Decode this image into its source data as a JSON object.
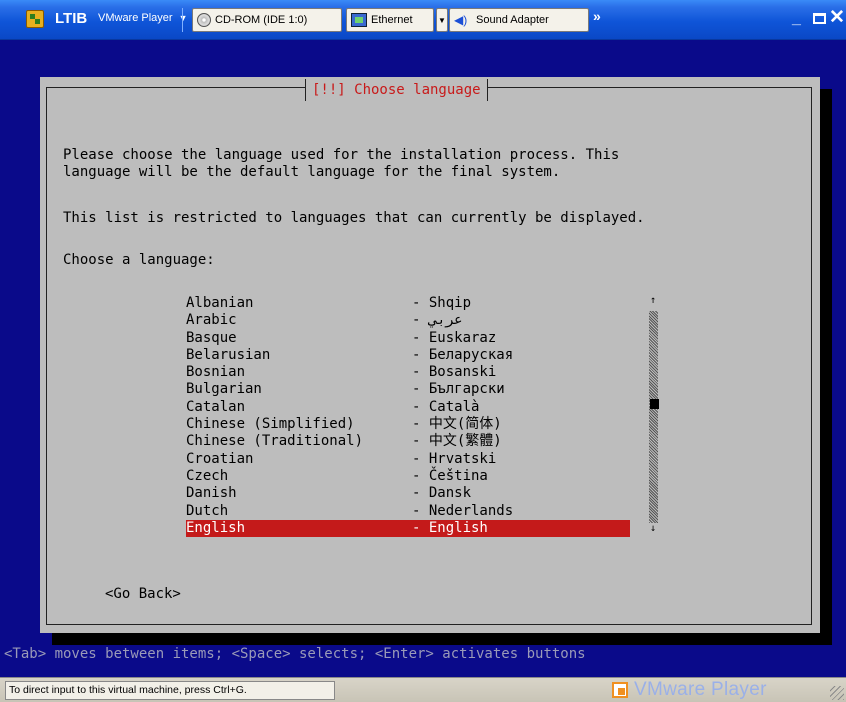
{
  "window": {
    "title": "LTIB",
    "menu": "VMware Player",
    "devices": [
      {
        "label": "CD-ROM (IDE 1:0)"
      },
      {
        "label": "Ethernet"
      },
      {
        "label": "Sound Adapter"
      }
    ],
    "more_glyph": "»",
    "minimize_glyph": "_",
    "close_glyph": "✕"
  },
  "dialog": {
    "title": "[!!] Choose language",
    "description_line1": "Please choose the language used for the installation process. This",
    "description_line2": "language will be the default language for the final system.",
    "restriction_note": "This list is restricted to languages that can currently be displayed.",
    "prompt": "Choose a language:",
    "languages": [
      {
        "name": "Albanian",
        "native": "- Shqip"
      },
      {
        "name": "Arabic",
        "native": "- عربي"
      },
      {
        "name": "Basque",
        "native": "- Euskaraz"
      },
      {
        "name": "Belarusian",
        "native": "- Беларуская"
      },
      {
        "name": "Bosnian",
        "native": "- Bosanski"
      },
      {
        "name": "Bulgarian",
        "native": "- Български"
      },
      {
        "name": "Catalan",
        "native": "- Català"
      },
      {
        "name": "Chinese (Simplified)",
        "native": "- 中文(简体)"
      },
      {
        "name": "Chinese (Traditional)",
        "native": "- 中文(繁體)"
      },
      {
        "name": "Croatian",
        "native": "- Hrvatski"
      },
      {
        "name": "Czech",
        "native": "- Čeština"
      },
      {
        "name": "Danish",
        "native": "- Dansk"
      },
      {
        "name": "Dutch",
        "native": "- Nederlands"
      },
      {
        "name": "English",
        "native": "- English"
      }
    ],
    "selected_language": "English",
    "scroll_up": "↑",
    "scroll_down": "↓",
    "go_back": "<Go Back>"
  },
  "help_line": "<Tab> moves between items; <Space> selects; <Enter> activates buttons",
  "status": {
    "message": "To direct input to this virtual machine, press Ctrl+G.",
    "brand": "VMware Player"
  },
  "colors": {
    "console_bg": "#0a0a8a",
    "dialog_bg": "#bdbdbd",
    "title_text": "#c81a1a",
    "selection_bg": "#c41a1a",
    "help_text": "#9a9ab8"
  }
}
